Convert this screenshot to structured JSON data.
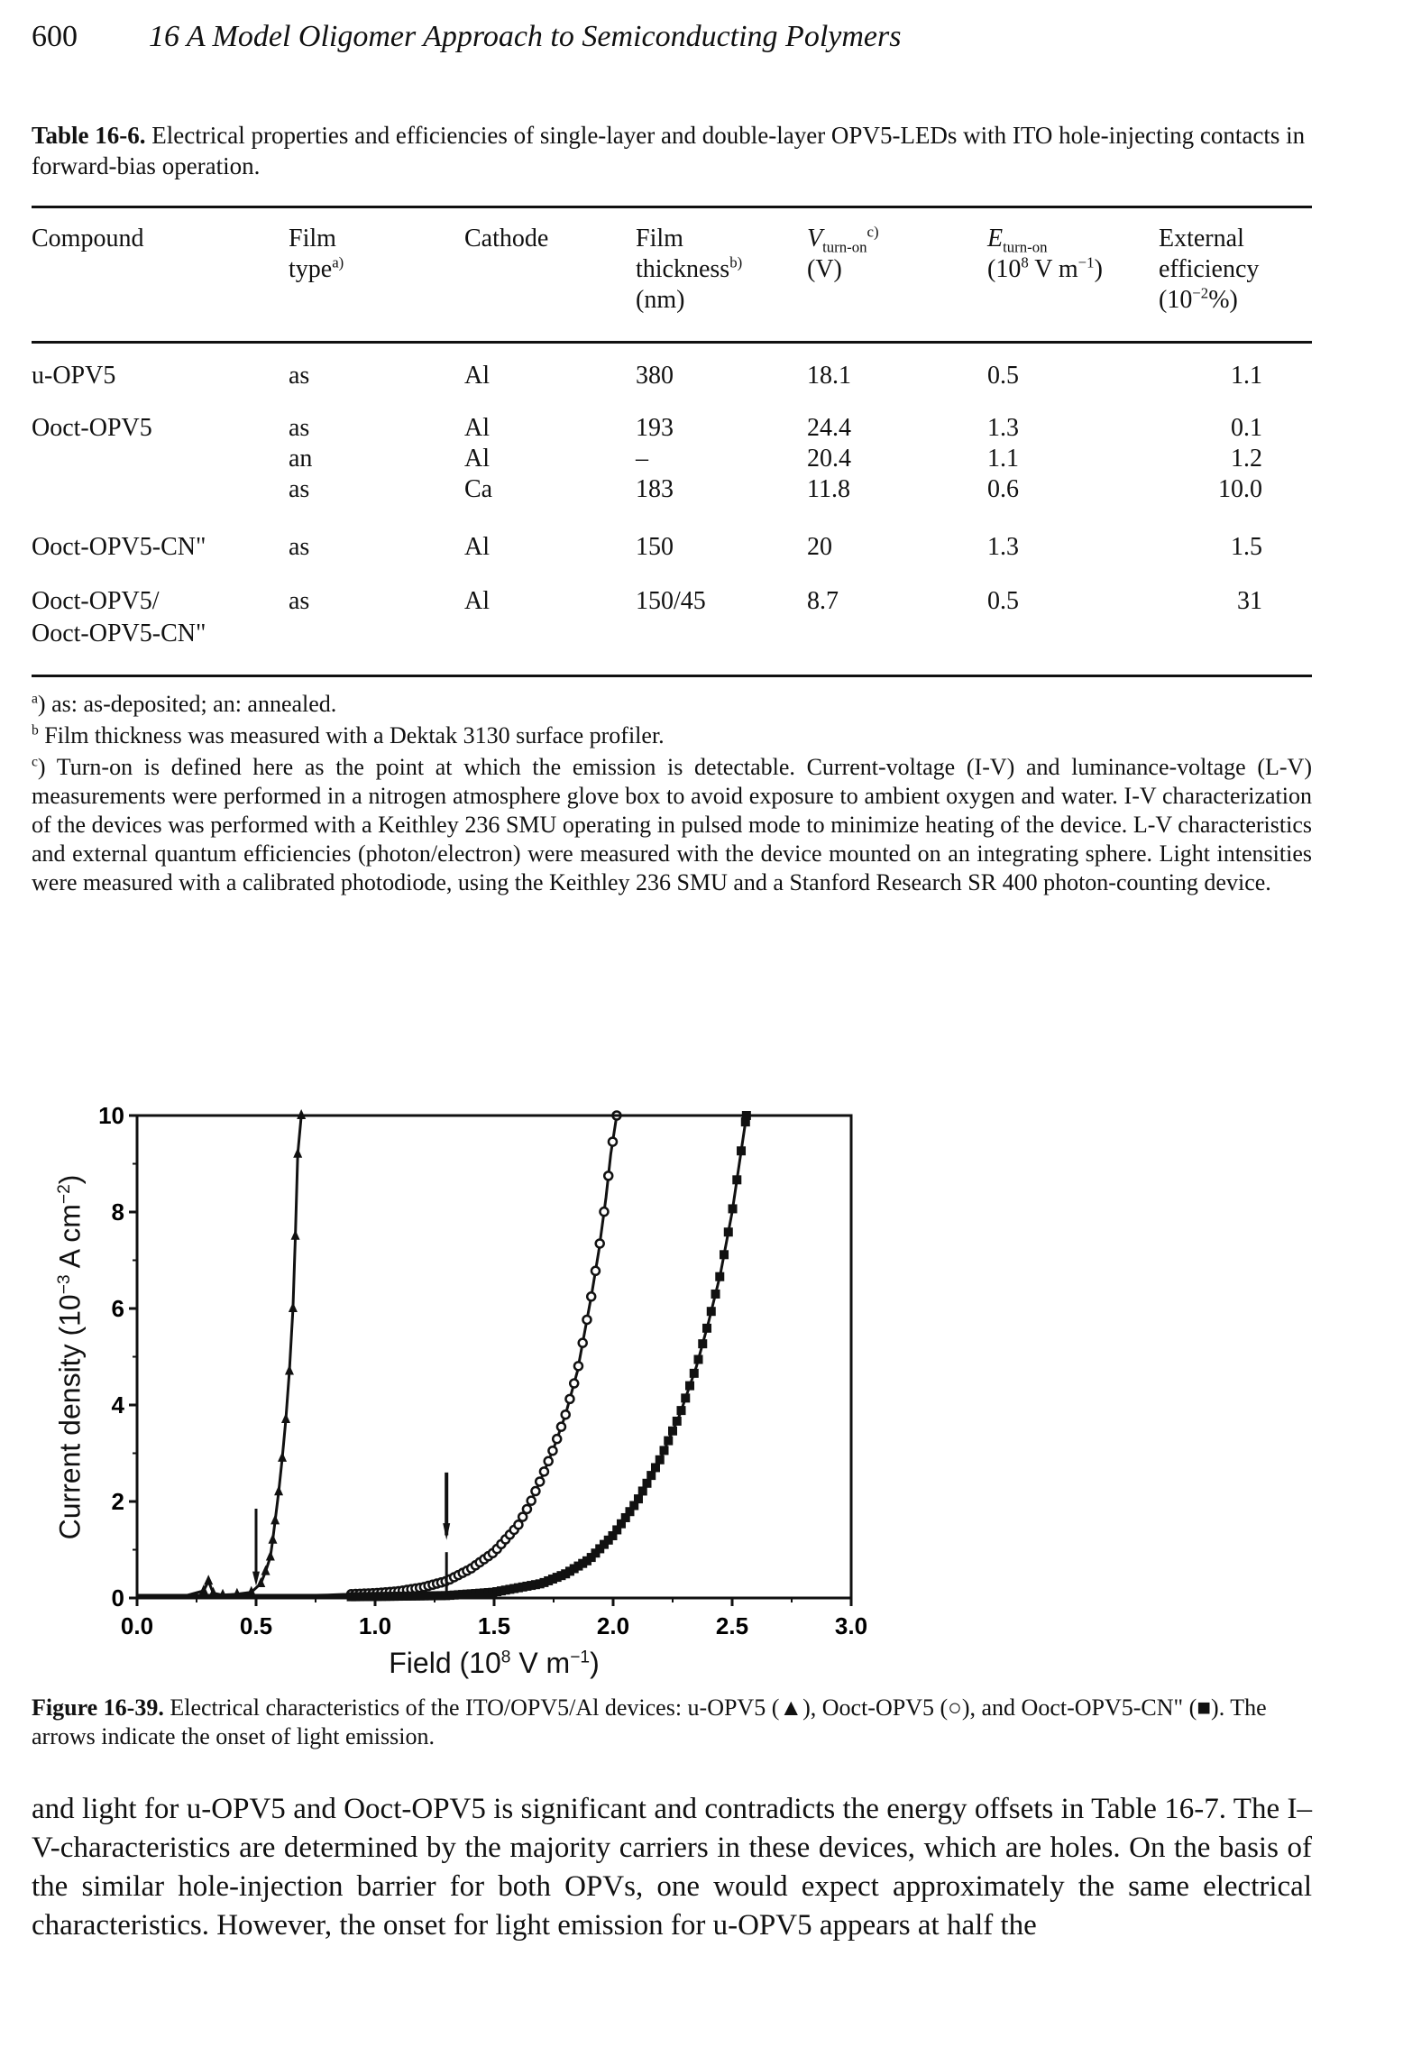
{
  "header": {
    "page_number": "600",
    "running_title": "16 A Model Oligomer Approach to Semiconducting Polymers"
  },
  "table": {
    "label": "Table 16-6.",
    "caption": "Electrical properties and efficiencies of single-layer and double-layer OPV5-LEDs with ITO hole-injecting contacts in forward-bias operation.",
    "columns": [
      {
        "lines": [
          "Compound"
        ]
      },
      {
        "lines": [
          "Film",
          "type"
        ],
        "sup": "a)"
      },
      {
        "lines": [
          "Cathode"
        ]
      },
      {
        "lines": [
          "Film",
          "thickness",
          "(nm)"
        ],
        "sup": "b)"
      },
      {
        "main": "V",
        "sub": "turn-on",
        "sup": "c)",
        "unit": "(V)"
      },
      {
        "main": "E",
        "sub": "turn-on",
        "unit": "(10^8 V m^-1)"
      },
      {
        "lines": [
          "External",
          "efficiency",
          "(10^-2 %)"
        ]
      }
    ],
    "rows": [
      {
        "compound": "u-OPV5",
        "type": "as",
        "cathode": "Al",
        "thickness": "380",
        "v_turn_on": "18.1",
        "e_turn_on": "0.5",
        "efficiency": "1.1"
      },
      {
        "compound": "Ooct-OPV5",
        "type": "as",
        "cathode": "Al",
        "thickness": "193",
        "v_turn_on": "24.4",
        "e_turn_on": "1.3",
        "efficiency": "0.1"
      },
      {
        "compound": "",
        "type": "an",
        "cathode": "Al",
        "thickness": "–",
        "v_turn_on": "20.4",
        "e_turn_on": "1.1",
        "efficiency": "1.2"
      },
      {
        "compound": "",
        "type": "as",
        "cathode": "Ca",
        "thickness": "183",
        "v_turn_on": "11.8",
        "e_turn_on": "0.6",
        "efficiency": "10.0"
      },
      {
        "compound": "Ooct-OPV5-CN\"",
        "type": "as",
        "cathode": "Al",
        "thickness": "150",
        "v_turn_on": "20",
        "e_turn_on": "1.3",
        "efficiency": "1.5"
      },
      {
        "compound": "Ooct-OPV5/",
        "compound2": "Ooct-OPV5-CN\"",
        "type": "as",
        "cathode": "Al",
        "thickness": "150/45",
        "v_turn_on": "8.7",
        "e_turn_on": "0.5",
        "efficiency": "31"
      }
    ],
    "footnotes": {
      "a": "as: as-deposited; an: annealed.",
      "b": "Film thickness was measured with a Dektak 3130 surface profiler.",
      "c": "Turn-on is defined here as the point at which the emission is detectable. Current-voltage (I-V) and luminance-voltage (L-V) measurements were performed in a nitrogen atmosphere glove box to avoid exposure to ambient oxygen and water. I-V characterization of the devices was performed with a Keithley 236 SMU operating in pulsed mode to minimize heating of the device. L-V characteristics and external quantum efficiencies (photon/electron) were measured with the device mounted on an integrating sphere. Light intensities were measured with a calibrated photodiode, using the Keithley 236 SMU and a Stanford Research SR 400 photon-counting device."
    }
  },
  "chart_data": {
    "type": "scatter",
    "title": "",
    "xlabel": "Field (10^8 V m^-1)",
    "ylabel": "Current density (10^-3 A cm^-2)",
    "xlim": [
      0,
      3.0
    ],
    "ylim": [
      0,
      10
    ],
    "x_ticks": [
      "0.0",
      "0.5",
      "1.0",
      "1.5",
      "2.0",
      "2.5",
      "3.0"
    ],
    "x_tick_values": [
      0,
      0.5,
      1.0,
      1.5,
      2.0,
      2.5,
      3.0
    ],
    "y_ticks": [
      "0",
      "2",
      "4",
      "6",
      "8",
      "10"
    ],
    "y_tick_values": [
      0,
      2,
      4,
      6,
      8,
      10
    ],
    "grid": false,
    "legend": "none (described in caption)",
    "series": [
      {
        "name": "u-OPV5",
        "marker": "triangle",
        "x": [
          0.0,
          0.1,
          0.2,
          0.28,
          0.3,
          0.32,
          0.36,
          0.42,
          0.48,
          0.52,
          0.54,
          0.56,
          0.57,
          0.58,
          0.595,
          0.61,
          0.625,
          0.64,
          0.655,
          0.665,
          0.675,
          0.69
        ],
        "y": [
          0.02,
          0.03,
          0.04,
          0.15,
          0.35,
          0.1,
          0.06,
          0.08,
          0.12,
          0.3,
          0.55,
          0.85,
          1.2,
          1.6,
          2.2,
          2.9,
          3.7,
          4.7,
          6.0,
          7.5,
          9.2,
          10.0
        ]
      },
      {
        "name": "Ooct-OPV5",
        "marker": "open-circle",
        "x": [
          0.0,
          0.4,
          0.8,
          1.0,
          1.1,
          1.2,
          1.3,
          1.4,
          1.5,
          1.6,
          1.65,
          1.7,
          1.75,
          1.8,
          1.85,
          1.88,
          1.91,
          1.94,
          1.97,
          1.99,
          2.015
        ],
        "y": [
          0.01,
          0.02,
          0.06,
          0.1,
          0.14,
          0.22,
          0.35,
          0.6,
          0.95,
          1.5,
          1.95,
          2.5,
          3.1,
          3.8,
          4.7,
          5.5,
          6.3,
          7.2,
          8.3,
          9.2,
          10.0
        ]
      },
      {
        "name": "Ooct-OPV5-CN\"",
        "marker": "filled-square",
        "x": [
          0.0,
          0.5,
          1.0,
          1.3,
          1.5,
          1.7,
          1.8,
          1.9,
          2.0,
          2.1,
          2.2,
          2.28,
          2.35,
          2.4,
          2.45,
          2.5,
          2.53,
          2.56
        ],
        "y": [
          0.0,
          0.01,
          0.03,
          0.05,
          0.12,
          0.3,
          0.5,
          0.8,
          1.3,
          2.0,
          2.9,
          3.8,
          4.8,
          5.7,
          6.7,
          8.0,
          9.0,
          10.0
        ]
      }
    ],
    "annotations": [
      {
        "type": "arrow-down",
        "x": 0.5,
        "label": "onset of light emission (u-OPV5)"
      },
      {
        "type": "arrow-down",
        "x": 1.3,
        "label": "onset of light emission (Ooct-OPV5)"
      }
    ]
  },
  "figure": {
    "label": "Figure 16-39.",
    "caption_a": "Electrical characteristics of the ITO/OPV5/Al devices: u-OPV5 (",
    "sym_triangle": "▲",
    "caption_b": "), Ooct-OPV5 (",
    "sym_circle": "○",
    "caption_c": "), and Ooct-OPV5-CN\" (",
    "sym_square": "■",
    "caption_d": "). The arrows indicate the onset of light emission."
  },
  "body": {
    "paragraph": "and light for u-OPV5 and Ooct-OPV5 is significant and contradicts the energy offsets in Table 16-7. The I–V-characteristics are determined by the majority carriers in these devices, which are holes. On the basis of the similar hole-injection barrier for both OPVs, one would expect approximately the same electrical characteristics. However, the onset for light emission for u-OPV5 appears at half the"
  }
}
